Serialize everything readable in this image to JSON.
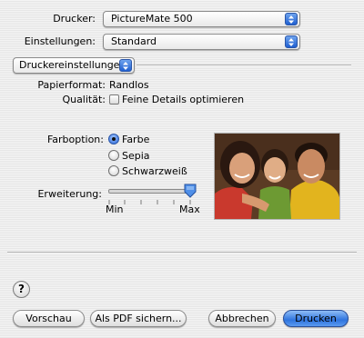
{
  "printer": {
    "label": "Drucker:",
    "value": "PictureMate 500"
  },
  "settings": {
    "label": "Einstellungen:",
    "value": "Standard"
  },
  "panel": {
    "value": "Druckereinstellungen"
  },
  "paper": {
    "label": "Papierformat:",
    "value": "Randlos"
  },
  "quality": {
    "label": "Qualität:",
    "checkbox_label": "Feine Details optimieren",
    "checked": false
  },
  "color_option": {
    "label": "Farboption:",
    "options": [
      "Farbe",
      "Sepia",
      "Schwarzweiß"
    ],
    "selected": "Farbe"
  },
  "expansion": {
    "label": "Erweiterung:",
    "min_label": "Min",
    "max_label": "Max",
    "level": 1.0
  },
  "buttons": {
    "help": "?",
    "preview": "Vorschau",
    "save_pdf": "Als PDF sichern...",
    "cancel": "Abbrechen",
    "print": "Drucken"
  },
  "colors": {
    "accent": "#2f74de"
  }
}
